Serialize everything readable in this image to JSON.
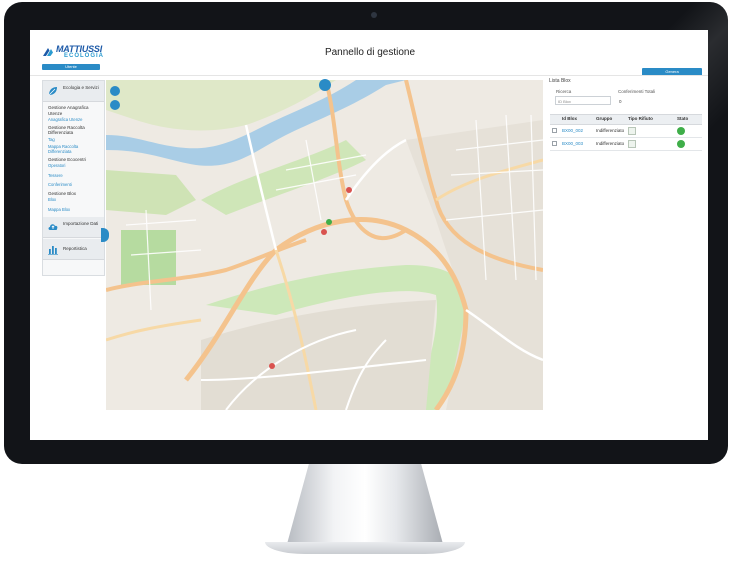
{
  "app": {
    "logo_name": "MATTIUSSI",
    "logo_sub": "ECOLOGIA",
    "user_button": "Utente",
    "page_title": "Pannello di gestione",
    "generate_button": "Genera"
  },
  "sidebar": {
    "section1": "Ecologia e Servizi",
    "items": [
      {
        "type": "text",
        "label": "Gestione Anagrafica"
      },
      {
        "type": "text",
        "label": "Utenze"
      },
      {
        "type": "link",
        "label": "Anagrafica Utenze"
      },
      {
        "type": "text",
        "label": "Gestione Raccolta Differenziata"
      },
      {
        "type": "link",
        "label": "Tag"
      },
      {
        "type": "link",
        "label": "Mappa Raccolta Differenziata"
      },
      {
        "type": "text",
        "label": "Gestione Ecocentri"
      },
      {
        "type": "link",
        "label": "Operatori"
      },
      {
        "type": "link",
        "label": "Tessere"
      },
      {
        "type": "link",
        "label": "Conferimenti"
      },
      {
        "type": "text",
        "label": "Gestione Blox"
      },
      {
        "type": "link",
        "label": "Blox"
      },
      {
        "type": "link",
        "label": "Mappa Blox"
      }
    ],
    "section2": "Importazione Dati",
    "section3": "Reportistica"
  },
  "list": {
    "title": "Lista Blox",
    "search_label": "Ricerca",
    "search_placeholder": "ID Blox",
    "total_label": "Conferimenti Totali",
    "total_value": "0",
    "columns": [
      "Id Blox",
      "Gruppo",
      "Tipo Rifiuto",
      "Stato"
    ],
    "rows": [
      {
        "id": "BX00_002",
        "group": "Indifferenziato"
      },
      {
        "id": "BX00_003",
        "group": "Indifferenziato"
      }
    ]
  }
}
